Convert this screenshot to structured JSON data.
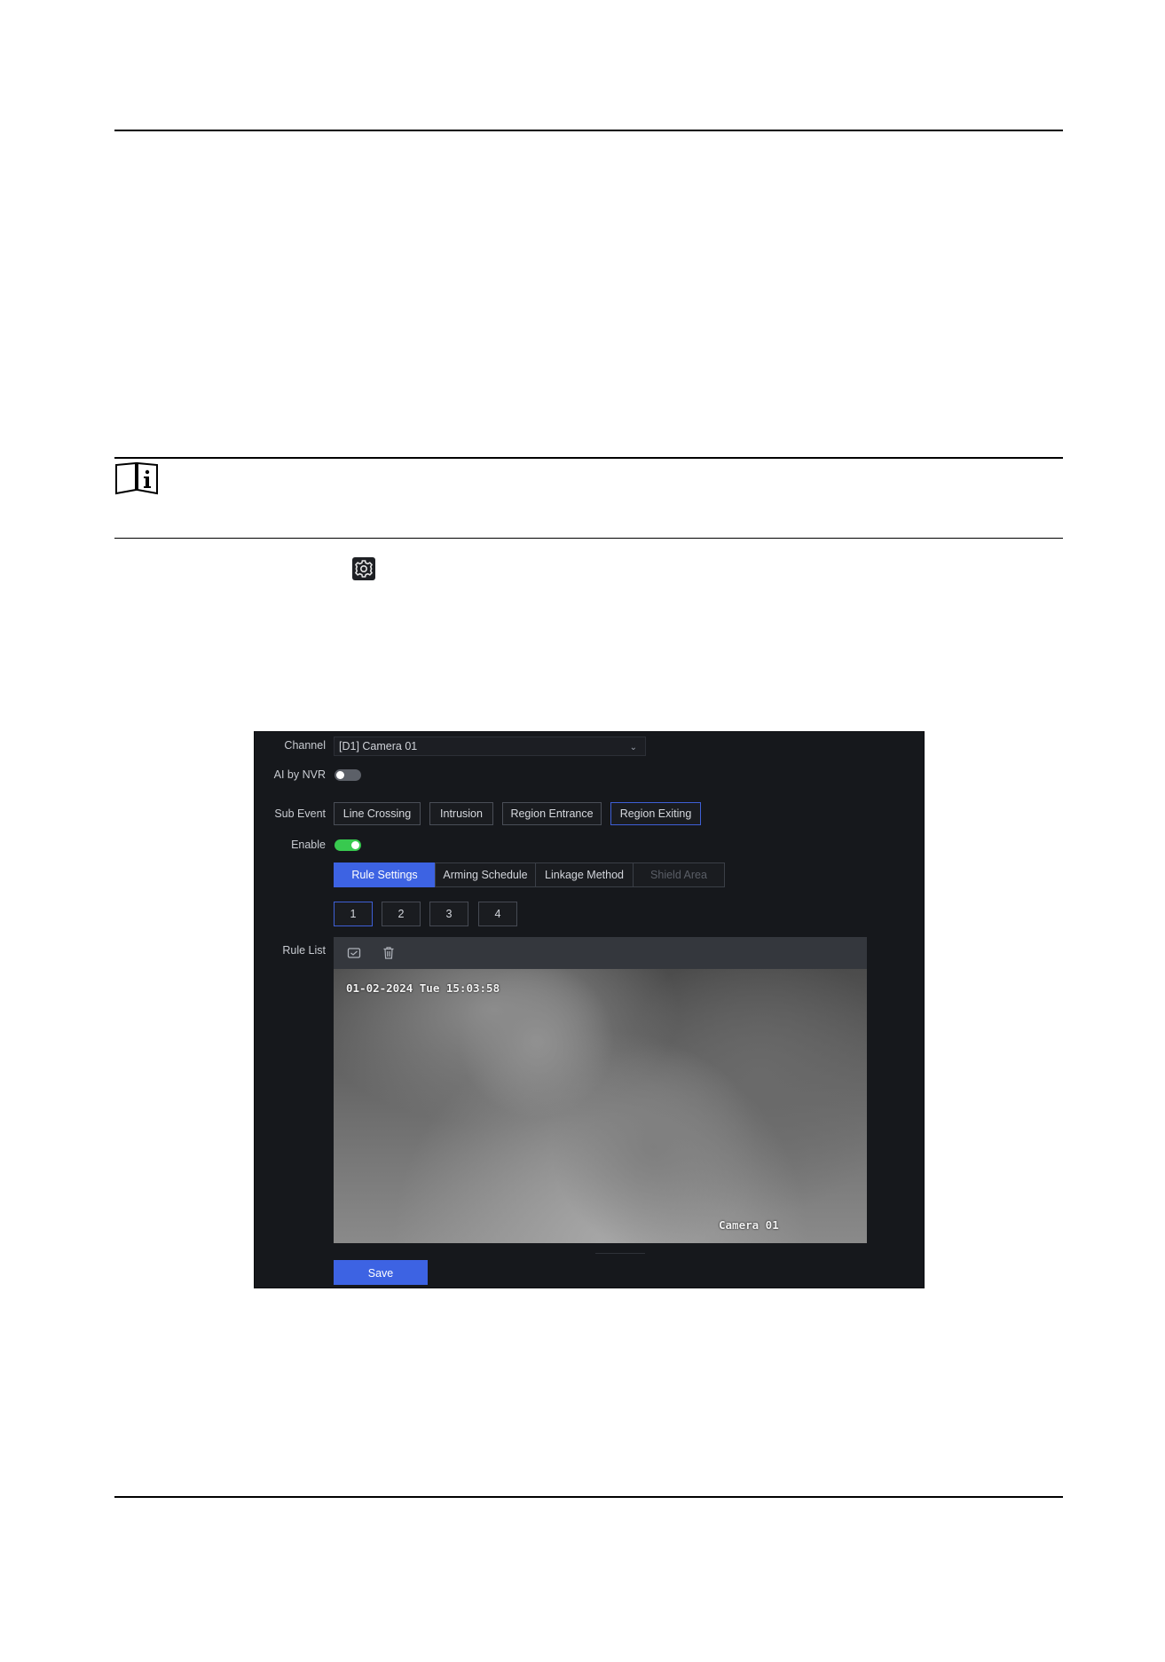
{
  "ui": {
    "channel_label": "Channel",
    "channel_value": "[D1] Camera 01",
    "ai_label": "AI by NVR",
    "ai_enabled": false,
    "sub_event_label": "Sub Event",
    "sub_events": [
      "Line Crossing",
      "Intrusion",
      "Region Entrance",
      "Region Exiting"
    ],
    "selected_sub_event": "Region Exiting",
    "enable_label": "Enable",
    "enabled": true,
    "tabs": [
      "Rule Settings",
      "Arming Schedule",
      "Linkage Method",
      "Shield Area"
    ],
    "active_tab": "Rule Settings",
    "disabled_tab": "Shield Area",
    "rule_numbers": [
      "1",
      "2",
      "3",
      "4"
    ],
    "active_rule": "1",
    "rule_list_label": "Rule List",
    "toolbar_icons": [
      "draw-area-icon",
      "delete-icon"
    ],
    "video_timestamp": "01-02-2024 Tue 15:03:58",
    "video_camera_name": "Camera 01",
    "save_label": "Save"
  },
  "colors": {
    "accent": "#3d63e3",
    "toggle_on": "#38c94f",
    "panel_bg": "#16181c"
  }
}
